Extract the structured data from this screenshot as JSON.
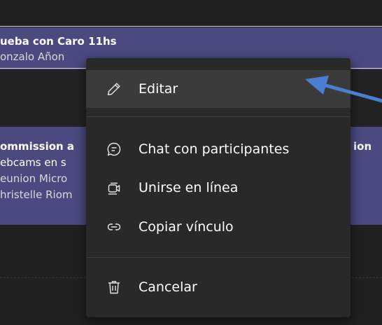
{
  "calendar": {
    "events": [
      {
        "title": "ueba con Caro 11hs",
        "lines": [
          "onzalo Añon"
        ]
      },
      {
        "title": "ommission a",
        "title_right": "ion",
        "lines": [
          "ebcams en s",
          "eunion Micro",
          "hristelle Riom"
        ]
      }
    ]
  },
  "context_menu": {
    "items": [
      {
        "id": "edit",
        "label": "Editar",
        "icon": "pencil-icon"
      },
      {
        "id": "chat",
        "label": "Chat con participantes",
        "icon": "chat-icon"
      },
      {
        "id": "join",
        "label": "Unirse en línea",
        "icon": "video-join-icon"
      },
      {
        "id": "copy",
        "label": "Copiar vínculo",
        "icon": "link-icon"
      },
      {
        "id": "cancel",
        "label": "Cancelar",
        "icon": "trash-icon"
      }
    ]
  },
  "colors": {
    "event_bg": "#4a4a80",
    "menu_bg": "#292929",
    "menu_hover": "#3b3b3b",
    "arrow": "#4a7ed0"
  }
}
